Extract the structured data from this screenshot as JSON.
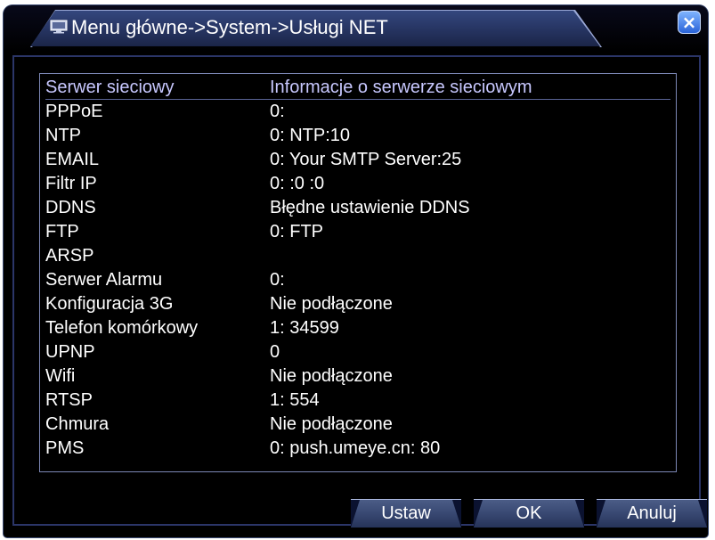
{
  "window": {
    "title": "Menu główne->System->Usługi NET",
    "close_label": "×"
  },
  "table": {
    "headers": [
      "Serwer sieciowy",
      "Informacje o serwerze sieciowym"
    ],
    "rows": [
      {
        "name": "PPPoE",
        "info": "0:"
      },
      {
        "name": "NTP",
        "info": "0: NTP:10"
      },
      {
        "name": "EMAIL",
        "info": "0: Your SMTP Server:25"
      },
      {
        "name": "Filtr IP",
        "info": "0: :0 :0"
      },
      {
        "name": "DDNS",
        "info": "Błędne ustawienie DDNS"
      },
      {
        "name": "FTP",
        "info": "0: FTP"
      },
      {
        "name": "ARSP",
        "info": ""
      },
      {
        "name": "Serwer Alarmu",
        "info": "0:"
      },
      {
        "name": "Konfiguracja 3G",
        "info": "Nie podłączone"
      },
      {
        "name": "Telefon komórkowy",
        "info": "1: 34599"
      },
      {
        "name": "UPNP",
        "info": "0"
      },
      {
        "name": "Wifi",
        "info": "Nie podłączone"
      },
      {
        "name": "RTSP",
        "info": "1: 554"
      },
      {
        "name": "Chmura",
        "info": "Nie podłączone"
      },
      {
        "name": "PMS",
        "info": "0: push.umeye.cn: 80"
      }
    ]
  },
  "buttons": {
    "set_label": "Ustaw",
    "ok_label": "OK",
    "cancel_label": "Anuluj"
  },
  "icons": {
    "title_icon": "monitor-icon",
    "close_icon": "close-icon"
  },
  "colors": {
    "background": "#000000",
    "title_tab": "#2d3d70",
    "button": "#3a4a74",
    "close_button": "#2a63d8",
    "text": "#ffffff"
  }
}
